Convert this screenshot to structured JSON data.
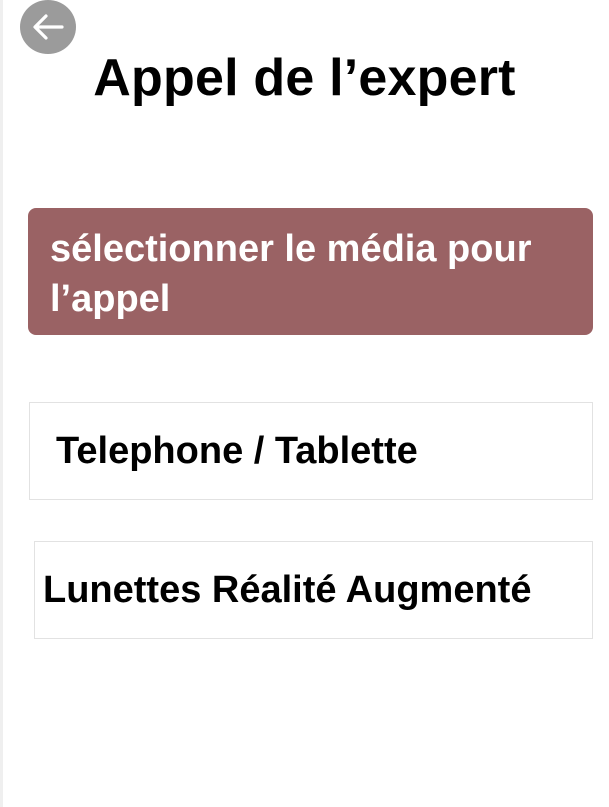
{
  "header": {
    "back_icon": "arrow-left-icon",
    "title": "Appel de l’expert"
  },
  "banner": {
    "text": "sélectionner le média pour\n l’appel",
    "color": "#9a6264"
  },
  "options": [
    {
      "label": "Telephone / Tablette"
    },
    {
      "label": "Lunettes Réalité Augmenté"
    }
  ]
}
